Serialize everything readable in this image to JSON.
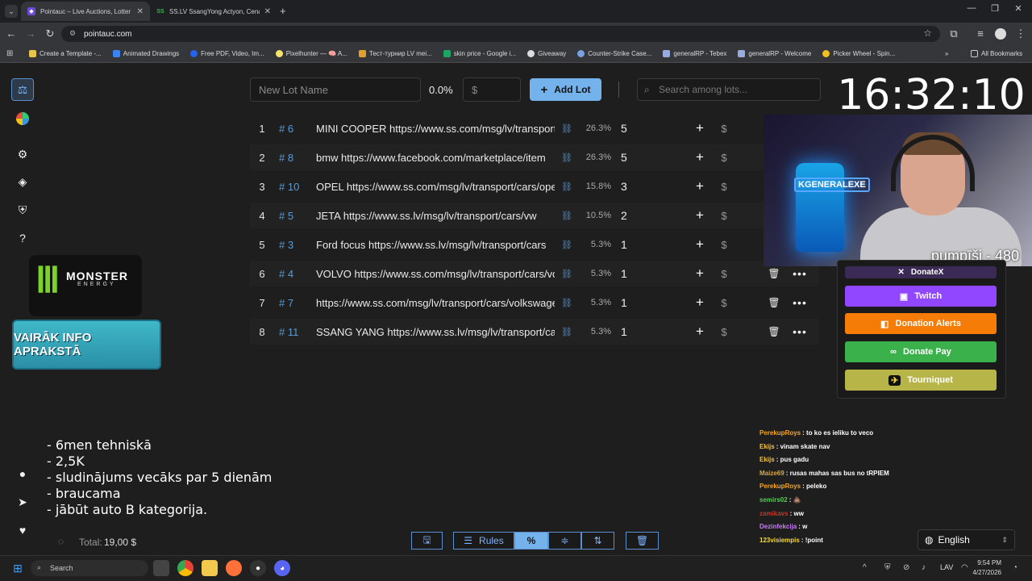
{
  "browser": {
    "tabs": [
      {
        "title": "Pointauc – Live Auctions, Lotter",
        "active": true
      },
      {
        "title": "SS.LV SsangYong Actyon, Cena",
        "active": false
      }
    ],
    "url": "pointauc.com",
    "bookmarks": [
      "Create a Template -...",
      "Animated Drawings",
      "Free PDF, Video, Im...",
      "Pixelhunter — 🧠 A...",
      "Тест-турнир LV mei...",
      "skin price - Google i...",
      "Giveaway",
      "Counter-Strike Case...",
      "generalRP - Tebex",
      "generalRP - Welcome",
      "Picker Wheel - Spin..."
    ],
    "all_bookmarks": "All Bookmarks"
  },
  "toolbar": {
    "lot_name_placeholder": "New Lot Name",
    "percent": "0.0%",
    "currency": "$",
    "add_lot_label": "Add Lot",
    "search_placeholder": "Search among lots..."
  },
  "clock": "16:32:10",
  "lots": [
    {
      "rank": "1",
      "id": "# 6",
      "name": "MINI COOPER https://www.ss.com/msg/lv/transport/cars/mini",
      "pct": "26.3%",
      "amount": "5",
      "actions": false
    },
    {
      "rank": "2",
      "id": "# 8",
      "name": "bmw  https://www.facebook.com/marketplace/item",
      "pct": "26.3%",
      "amount": "5",
      "actions": false
    },
    {
      "rank": "3",
      "id": "# 10",
      "name": "OPEL https://www.ss.com/msg/lv/transport/cars/opel",
      "pct": "15.8%",
      "amount": "3",
      "actions": false
    },
    {
      "rank": "4",
      "id": "# 5",
      "name": "JETA https://www.ss.lv/msg/lv/transport/cars/vw",
      "pct": "10.5%",
      "amount": "2",
      "actions": false
    },
    {
      "rank": "5",
      "id": "# 3",
      "name": "Ford focus https://www.ss.lv/msg/lv/transport/cars",
      "pct": "5.3%",
      "amount": "1",
      "actions": false
    },
    {
      "rank": "6",
      "id": "# 4",
      "name": "VOLVO https://www.ss.com/msg/lv/transport/cars/volvo",
      "pct": "5.3%",
      "amount": "1",
      "actions": true
    },
    {
      "rank": "7",
      "id": "# 7",
      "name": "https://www.ss.com/msg/lv/transport/cars/volkswagen",
      "pct": "5.3%",
      "amount": "1",
      "actions": true
    },
    {
      "rank": "8",
      "id": "# 11",
      "name": "SSANG YANG https://www.ss.lv/msg/lv/transport/cars",
      "pct": "5.3%",
      "amount": "1",
      "actions": true
    }
  ],
  "cam_label": "pumpīši - 480",
  "overlay": {
    "brand": "MONSTER",
    "brand_sub": "ENERGY",
    "info_banner": "VAIRĀK INFO APRAKSTĀ",
    "info_lines": [
      "- 6men tehniskā",
      "- 2,5K",
      "- sludinājums vecāks par 5 dienām",
      "- braucama",
      "- jābūt auto B kategorija."
    ]
  },
  "donate": {
    "buttons": [
      {
        "label": "DonateX",
        "color": "#3a2a55"
      },
      {
        "label": "Twitch",
        "color": "#9146ff"
      },
      {
        "label": "Donation Alerts",
        "color": "#f57d07"
      },
      {
        "label": "Donate Pay",
        "color": "#3ab14a"
      },
      {
        "label": "Tourniquet",
        "color": "#b8b548"
      }
    ]
  },
  "chat": [
    {
      "user": "PerekupRoys",
      "color": "#f5a623",
      "msg": "to ko es ieliku to veco"
    },
    {
      "user": "Ekijs",
      "color": "#f5c542",
      "msg": "vinam skate nav"
    },
    {
      "user": "Ekijs",
      "color": "#f5c542",
      "msg": "pus gadu"
    },
    {
      "user": "Maize69",
      "color": "#d4a94a",
      "msg": "rusas mahas sas bus no tRPIEM"
    },
    {
      "user": "PerekupRoys",
      "color": "#f5a623",
      "msg": "peleko"
    },
    {
      "user": "semirs02",
      "color": "#4fd14f",
      "msg": "💩"
    },
    {
      "user": "zamikavs",
      "color": "#c0392b",
      "msg": "ww"
    },
    {
      "user": "Dezinfekcija",
      "color": "#c97bf5",
      "msg": "w"
    },
    {
      "user": "123visiempis",
      "color": "#f5d742",
      "msg": "!point"
    }
  ],
  "footer": {
    "total_label": "Total:",
    "total_value": "19,00 $",
    "rules_label": "Rules",
    "language": "English"
  },
  "taskbar": {
    "search": "Search",
    "lang": "LAV",
    "time": "9:54 PM",
    "date": "4/27/2026"
  }
}
